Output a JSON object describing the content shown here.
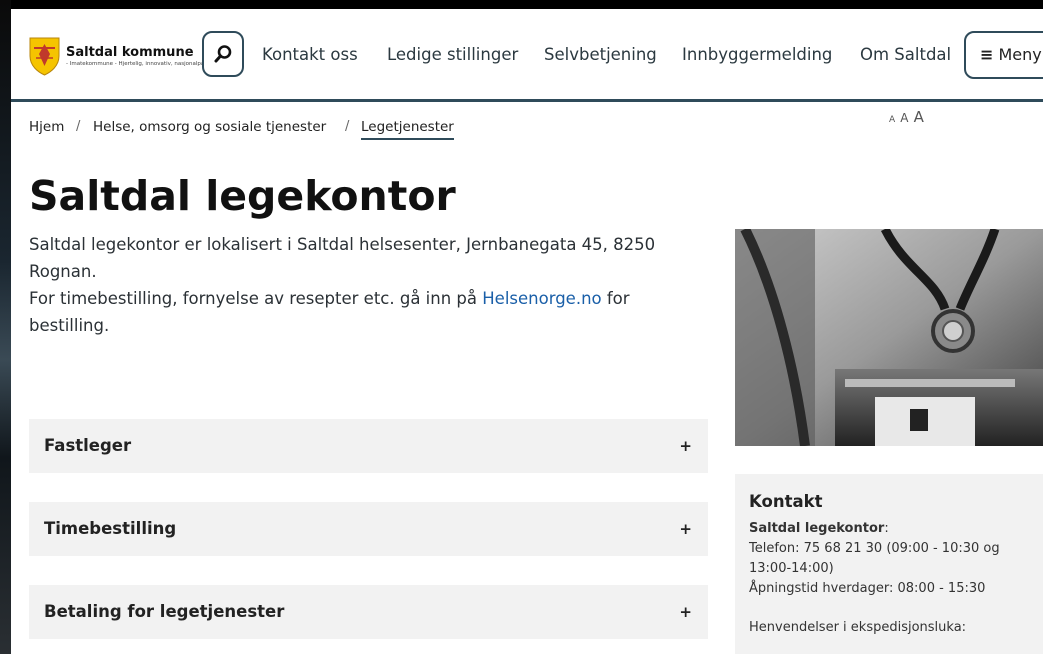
{
  "brand": {
    "name": "Saltdal kommune",
    "tagline": "- Imatekommune - Hjertelig, innovativ, nasjonalparkkommune og avrading",
    "shield_color": "#f5c400",
    "shield_accent": "#c0392b"
  },
  "header": {
    "nav": [
      "Kontakt oss",
      "Ledige stillinger",
      "Selvbetjening",
      "Innbyggermelding",
      "Om Saltdal"
    ],
    "menu_label": "Meny",
    "accent_color": "#2f4b5a"
  },
  "breadcrumb": [
    "Hjem",
    "Helse, omsorg og sosiale tjenester",
    "Legetjenester"
  ],
  "text_size": [
    "A",
    "A",
    "A"
  ],
  "page": {
    "title": "Saltdal legekontor",
    "intro_line1": "Saltdal legekontor er lokalisert i Saltdal helsesenter, Jernbanegata 45, 8250 Rognan.",
    "intro_line2_before": "For timebestilling, fornyelse av resepter etc. gå inn på ",
    "intro_link": "Helsenorge.no",
    "intro_line2_after": " for bestilling."
  },
  "accordion": [
    {
      "label": "Fastleger",
      "icon": "+"
    },
    {
      "label": "Timebestilling",
      "icon": "+"
    },
    {
      "label": "Betaling for legetjenester",
      "icon": "+"
    }
  ],
  "contact": {
    "title": "Kontakt",
    "office_name": "Saltdal legekontor",
    "office_colon": ":",
    "phone": "Telefon: 75 68 21 30 (09:00 - 10:30 og 13:00-14:00)",
    "hours": "Åpningstid hverdager: 08:00 - 15:30",
    "note": "Henvendelser i ekspedisjonsluka:"
  },
  "icons": {
    "search": "search-icon",
    "menu": "hamburger-icon",
    "logo": "coat-of-arms-icon"
  }
}
